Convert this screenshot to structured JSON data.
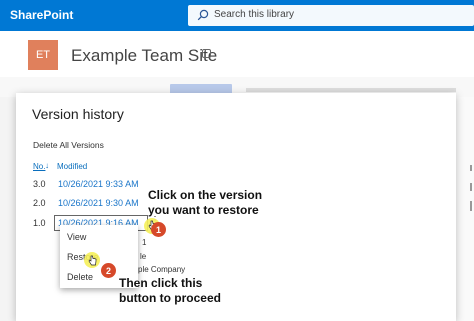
{
  "suite_bar": {
    "brand": "SharePoint",
    "search_placeholder": "Search this library"
  },
  "site": {
    "logo_text": "ET",
    "title": "Example Team Site"
  },
  "dialog": {
    "title": "Version history",
    "delete_all": "Delete All Versions",
    "columns": {
      "no": "No.",
      "no_sort": "↓",
      "modified": "Modified"
    },
    "rows": [
      {
        "version": "3.0",
        "modified": "10/26/2021 9:33 AM"
      },
      {
        "version": "2.0",
        "modified": "10/26/2021 9:30 AM"
      },
      {
        "version": "1.0",
        "modified": "10/26/2021 9:16 AM"
      }
    ],
    "row_menu_glyph": "⋮",
    "partially_hidden": {
      "size_fragment": "1",
      "field_fragment": "le",
      "company_fragment": "ple Company"
    }
  },
  "context_menu": {
    "items": [
      "View",
      "Restore",
      "Delete"
    ]
  },
  "annotations": {
    "step1": {
      "text_line1": "Click on the version",
      "text_line2": "you want to restore",
      "number": "1"
    },
    "step2": {
      "text_line1": "Then click this",
      "text_line2": "button to proceed",
      "number": "2"
    },
    "highlight_color": "#f5f05a",
    "badge_color": "#d6492a"
  },
  "colors": {
    "suite_bar": "#0078d4",
    "link": "#1b76c9",
    "site_logo": "#e0805c"
  }
}
